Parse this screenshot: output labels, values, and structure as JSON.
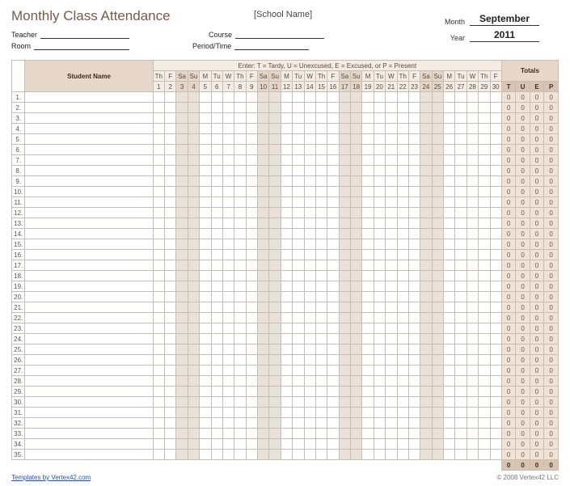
{
  "title": "Monthly Class Attendance",
  "school_placeholder": "[School Name]",
  "fields": {
    "teacher_label": "Teacher",
    "course_label": "Course",
    "room_label": "Room",
    "period_label": "Period/Time",
    "month_label": "Month",
    "year_label": "Year",
    "month_value": "September",
    "year_value": "2011"
  },
  "legend": "Enter:  T = Tardy,   U = Unexcused,   E = Excused,  or P = Present",
  "headers": {
    "student_name": "Student Name",
    "totals": "Totals"
  },
  "days_of_week": [
    "Th",
    "F",
    "Sa",
    "Su",
    "M",
    "Tu",
    "W",
    "Th",
    "F",
    "Sa",
    "Su",
    "M",
    "Tu",
    "W",
    "Th",
    "F",
    "Sa",
    "Su",
    "M",
    "Tu",
    "W",
    "Th",
    "F",
    "Sa",
    "Su",
    "M",
    "Tu",
    "W",
    "Th",
    "F"
  ],
  "day_numbers": [
    "1",
    "2",
    "3",
    "4",
    "5",
    "6",
    "7",
    "8",
    "9",
    "10",
    "11",
    "12",
    "13",
    "14",
    "15",
    "16",
    "17",
    "18",
    "19",
    "20",
    "21",
    "22",
    "23",
    "24",
    "25",
    "26",
    "27",
    "28",
    "29",
    "30"
  ],
  "weekend_indices": [
    2,
    3,
    9,
    10,
    16,
    17,
    23,
    24
  ],
  "total_codes": [
    "T",
    "U",
    "E",
    "P"
  ],
  "num_rows": 35,
  "zero": "0",
  "grand_totals": [
    "0",
    "0",
    "0",
    "0"
  ],
  "footer_link": "Templates by Vertex42.com",
  "footer_copy": "© 2008 Vertex42 LLC"
}
